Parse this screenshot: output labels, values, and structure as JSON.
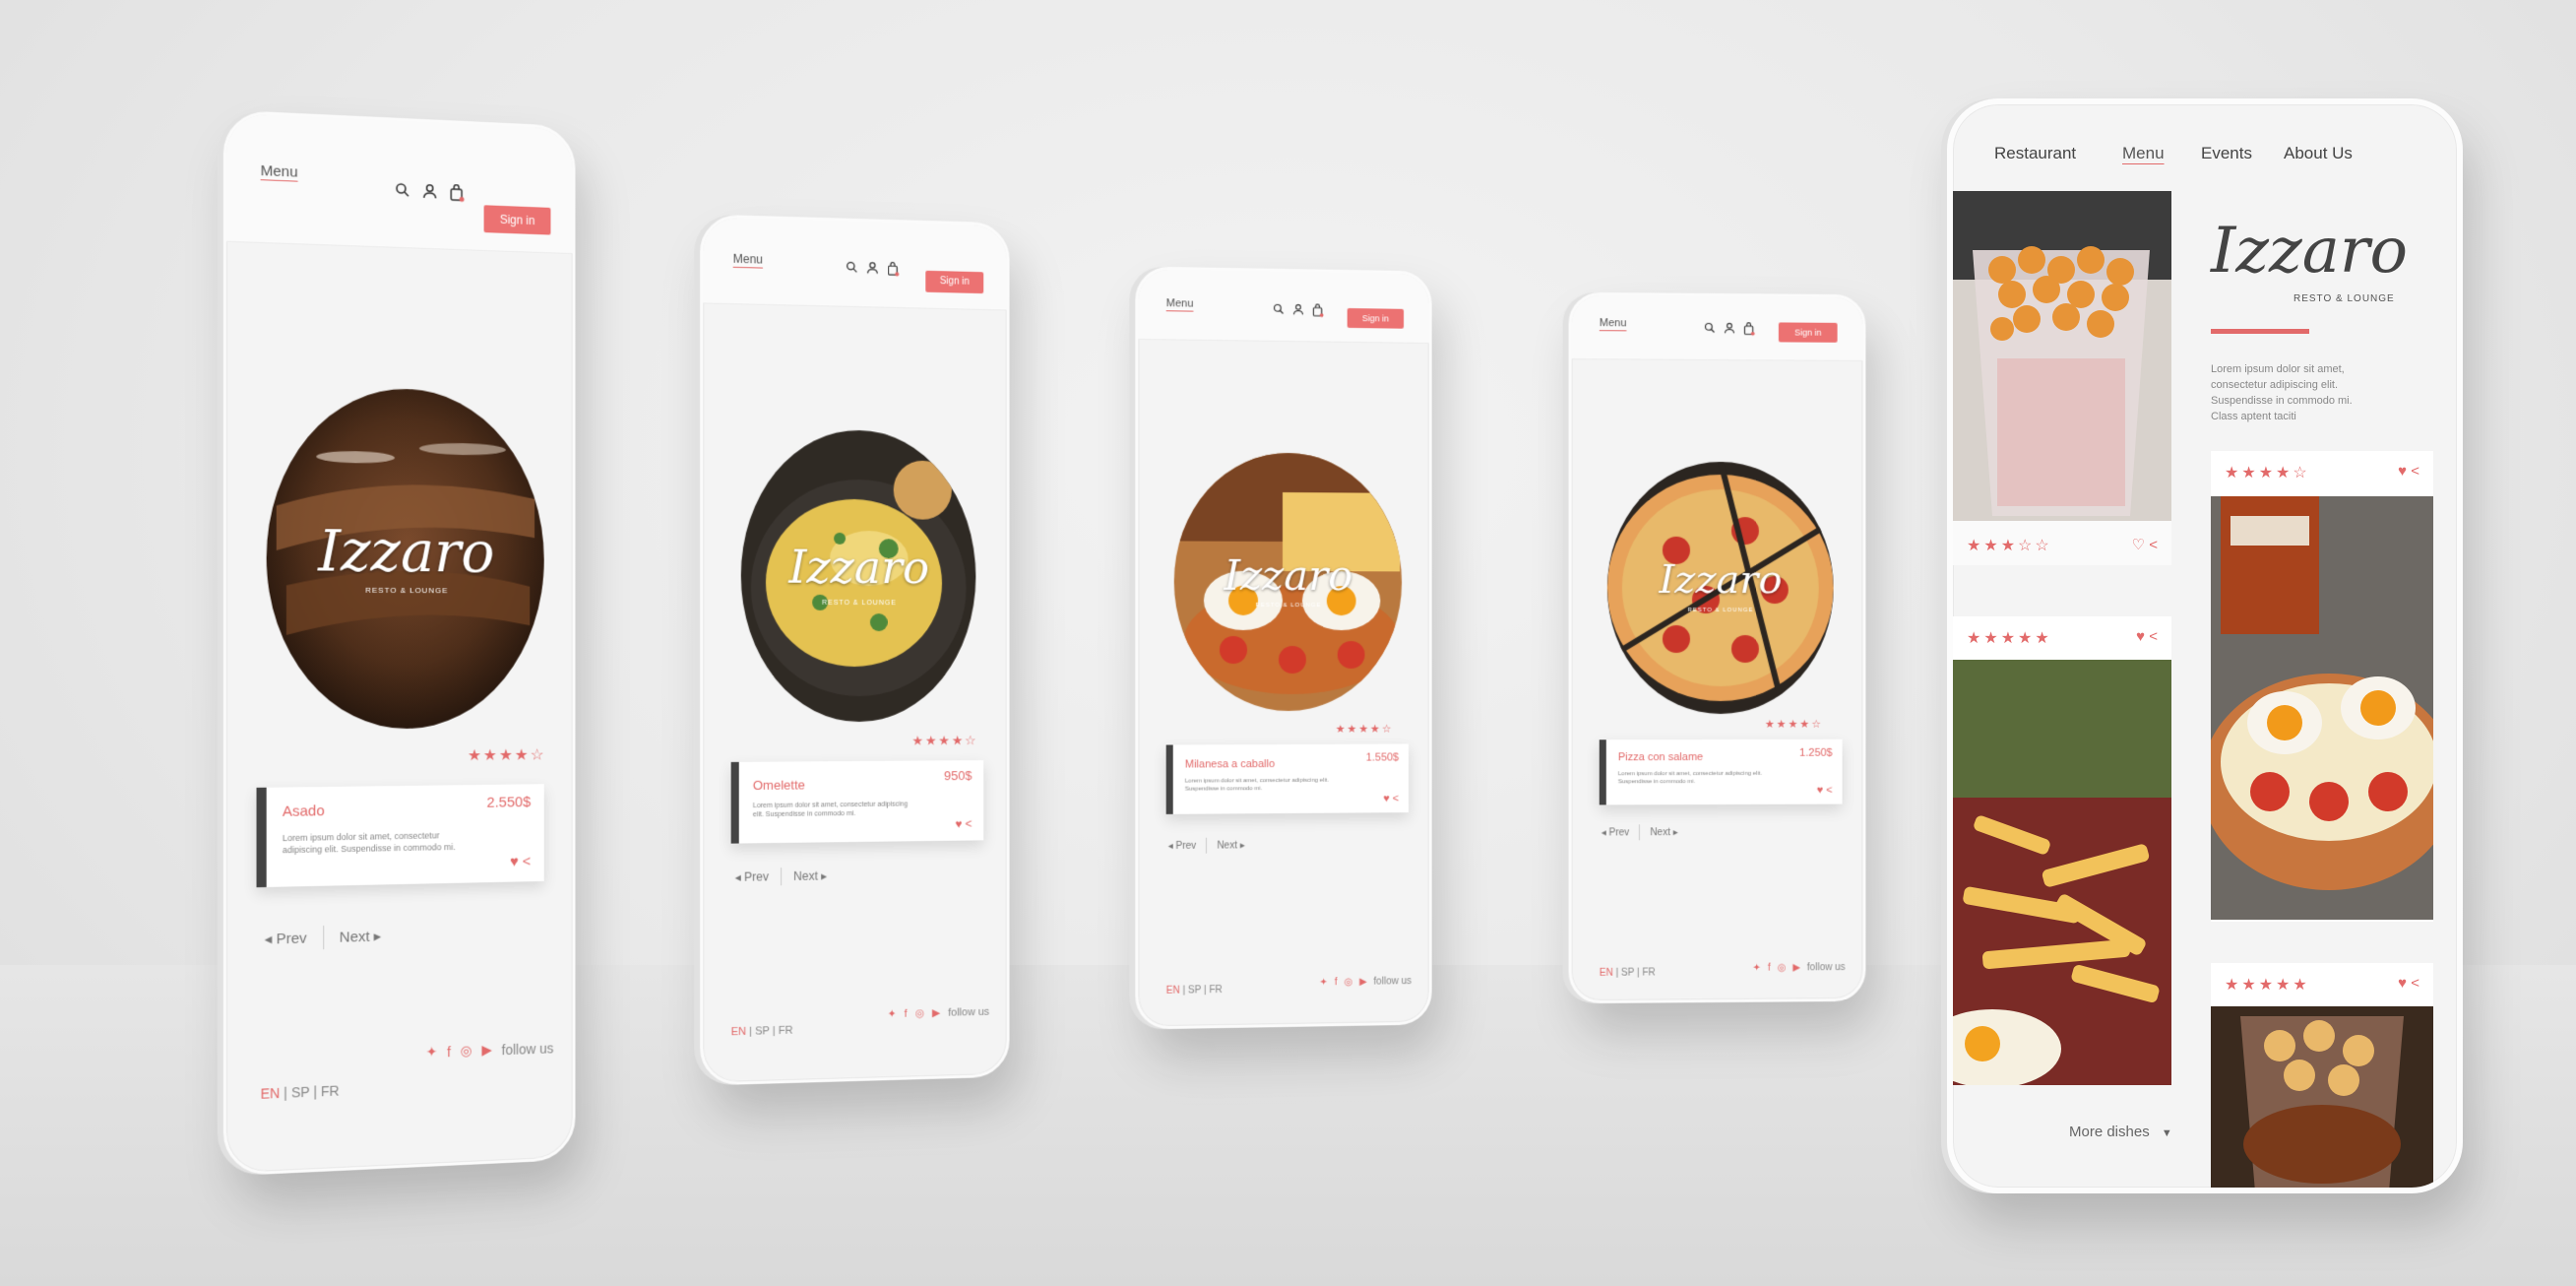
{
  "header": {
    "menu_label": "Menu",
    "signin_label": "Sign in",
    "icons": [
      "search-icon",
      "user-icon",
      "cart-icon"
    ]
  },
  "brand": {
    "name": "Izzaro",
    "tagline": "RESTO & LOUNGE"
  },
  "pager": {
    "prev": "Prev",
    "next": "Next"
  },
  "langs": {
    "en": "EN",
    "sp": "SP",
    "fr": "FR",
    "sep": "|"
  },
  "social": {
    "follow": "follow us",
    "icons": [
      "twitter-icon",
      "facebook-icon",
      "instagram-icon",
      "youtube-icon"
    ]
  },
  "phones": [
    {
      "dish": "Asado",
      "price": "2.550$",
      "desc": "Lorem ipsum dolor sit amet, consectetur adipiscing elit. Suspendisse in commodo mi.",
      "rating": 4,
      "image": "grilled-meat"
    },
    {
      "dish": "Omelette",
      "price": "950$",
      "desc": "Lorem ipsum dolor sit amet, consectetur adipiscing elit. Suspendisse in commodo mi.",
      "rating": 4,
      "image": "omelette"
    },
    {
      "dish": "Milanesa a caballo",
      "price": "1.550$",
      "desc": "Lorem ipsum dolor sit amet, consectetur adipiscing elit. Suspendisse in commodo mi.",
      "rating": 4,
      "image": "milanesa"
    },
    {
      "dish": "Pizza con salame",
      "price": "1.250$",
      "desc": "Lorem ipsum dolor sit amet, consectetur adipiscing elit. Suspendisse in commodo mi.",
      "rating": 4,
      "image": "pizza"
    }
  ],
  "big_phone": {
    "nav": [
      "Restaurant",
      "Menu",
      "Events",
      "About Us"
    ],
    "active_nav": "Menu",
    "lorem": "Lorem ipsum dolor sit amet, consectetur adipiscing elit. Suspendisse in commodo mi. Class aptent taciti",
    "more_dishes": "More dishes",
    "tiles": [
      {
        "image": "fried-snack-cup",
        "rating": 3
      },
      {
        "image": "fries-and-egg",
        "rating": 5
      },
      {
        "image": "egg-milanesa-beer",
        "rating": 4
      },
      {
        "image": "dessert-cup",
        "rating": 5
      }
    ]
  },
  "colors": {
    "accent": "#e26a6a",
    "card_border": "#444444",
    "screen_bg": "#f4f4f4"
  }
}
